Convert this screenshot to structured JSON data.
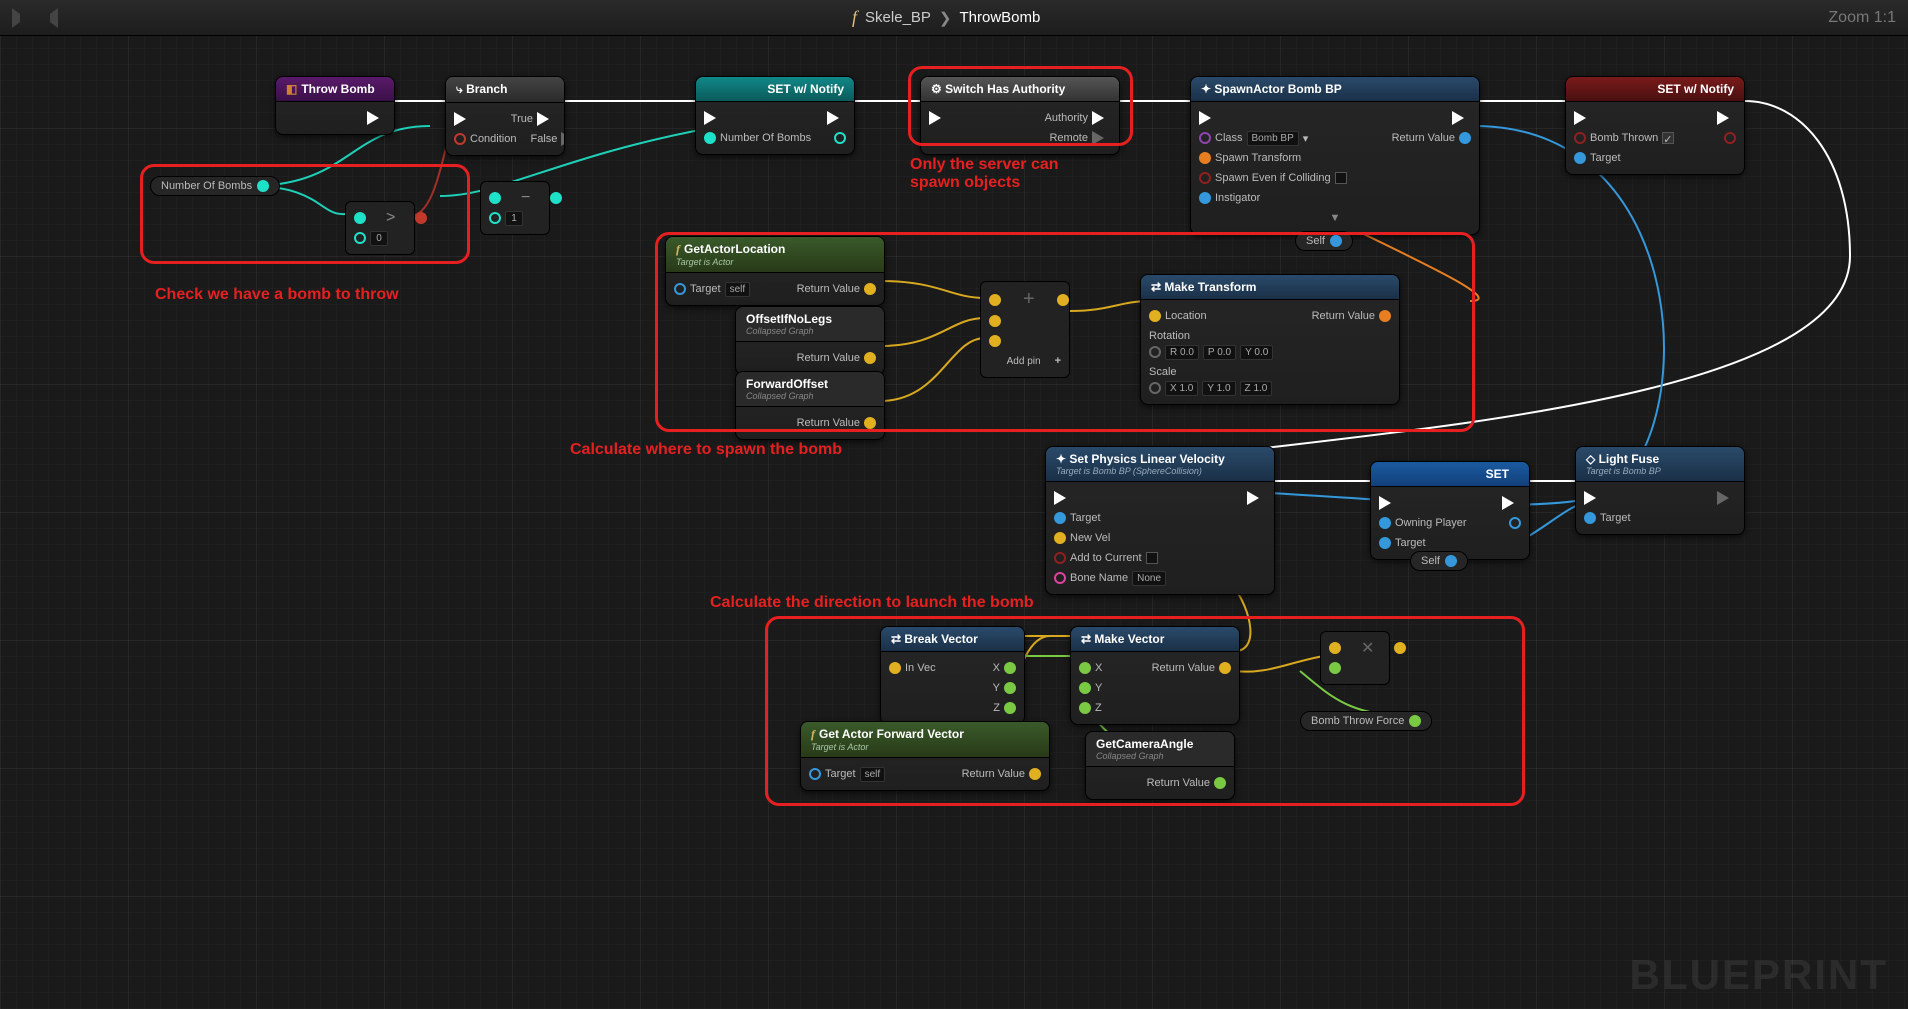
{
  "toolbar": {
    "blueprint": "Skele_BP",
    "func": "ThrowBomb",
    "zoom": "Zoom 1:1"
  },
  "watermark": "BLUEPRINT",
  "annotations": {
    "check": "Check we have a bomb to throw",
    "server": "Only the server can spawn objects",
    "spawn": "Calculate where to spawn the bomb",
    "launch": "Calculate the direction to launch the bomb"
  },
  "nodes": {
    "throwBomb": "Throw Bomb",
    "branch": {
      "title": "Branch",
      "cond": "Condition",
      "t": "True",
      "f": "False"
    },
    "set1": {
      "title": "SET w/ Notify",
      "var": "Number Of Bombs"
    },
    "switch": {
      "title": "Switch Has Authority",
      "a": "Authority",
      "r": "Remote"
    },
    "spawn": {
      "title": "SpawnActor Bomb BP",
      "class": "Class",
      "classVal": "Bomb BP",
      "st": "Spawn Transform",
      "col": "Spawn Even if Colliding",
      "inst": "Instigator",
      "ret": "Return Value"
    },
    "set2": {
      "title": "SET w/ Notify",
      "var": "Bomb Thrown",
      "tgt": "Target"
    },
    "nob": "Number Of Bombs",
    "gt": "0",
    "minus": "1",
    "gal": {
      "title": "GetActorLocation",
      "sub": "Target is Actor",
      "tgt": "Target",
      "self": "self",
      "ret": "Return Value"
    },
    "off1": {
      "title": "OffsetIfNoLegs",
      "sub": "Collapsed Graph",
      "ret": "Return Value"
    },
    "off2": {
      "title": "ForwardOffset",
      "sub": "Collapsed Graph",
      "ret": "Return Value"
    },
    "addpin": "Add pin",
    "plus": "+",
    "mt": {
      "title": "Make Transform",
      "loc": "Location",
      "rot": "Rotation",
      "scl": "Scale",
      "ret": "Return Value",
      "rr": "R",
      "rp": "P",
      "ry": "Y",
      "rv": "0.0",
      "sx": "X",
      "sy": "Y",
      "sz": "Z",
      "sv": "1.0"
    },
    "self": "Self",
    "splv": {
      "title": "Set Physics Linear Velocity",
      "sub": "Target is Bomb BP (SphereCollision)",
      "tgt": "Target",
      "nv": "New Vel",
      "add": "Add to Current",
      "bn": "Bone Name",
      "none": "None"
    },
    "set3": {
      "title": "SET",
      "op": "Owning Player",
      "tgt": "Target"
    },
    "lf": {
      "title": "Light Fuse",
      "sub": "Target is Bomb BP",
      "tgt": "Target"
    },
    "self2": "Self",
    "bv": {
      "title": "Break Vector",
      "iv": "In Vec",
      "x": "X",
      "y": "Y",
      "z": "Z"
    },
    "mv": {
      "title": "Make Vector",
      "x": "X",
      "y": "Y",
      "z": "Z",
      "ret": "Return Value"
    },
    "gafv": {
      "title": "Get Actor Forward Vector",
      "sub": "Target is Actor",
      "tgt": "Target",
      "self": "self",
      "ret": "Return Value"
    },
    "gca": {
      "title": "GetCameraAngle",
      "sub": "Collapsed Graph",
      "ret": "Return Value"
    },
    "btf": "Bomb Throw Force"
  }
}
